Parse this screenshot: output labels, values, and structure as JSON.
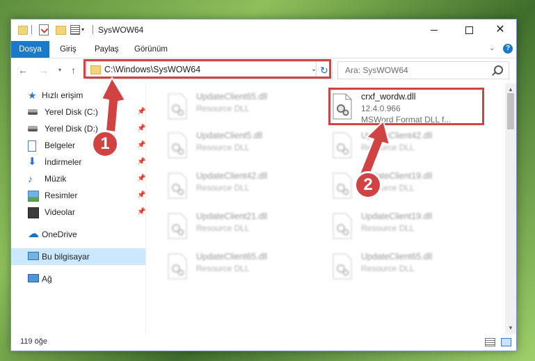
{
  "window": {
    "title": "SysWOW64"
  },
  "ribbon": {
    "tabs": [
      "Dosya",
      "Giriş",
      "Paylaş",
      "Görünüm"
    ]
  },
  "nav": {
    "address": "C:\\Windows\\SysWOW64",
    "search_placeholder": "Ara: SysWOW64"
  },
  "sidebar": {
    "quick_access": "Hızlı erişim",
    "items": [
      {
        "label": "Yerel Disk (C:)",
        "icon": "disk-icon"
      },
      {
        "label": "Yerel Disk (D:)",
        "icon": "disk-icon"
      },
      {
        "label": "Belgeler",
        "icon": "documents-icon"
      },
      {
        "label": "İndirmeler",
        "icon": "downloads-icon"
      },
      {
        "label": "Müzik",
        "icon": "music-icon"
      },
      {
        "label": "Resimler",
        "icon": "pictures-icon"
      },
      {
        "label": "Videolar",
        "icon": "videos-icon"
      }
    ],
    "onedrive": "OneDrive",
    "this_pc": "Bu bilgisayar",
    "network": "Ağ"
  },
  "files": {
    "left_column": [
      {
        "name": "UpdateClient65.dll",
        "type": "Resource DLL"
      },
      {
        "name": "UpdateClient5.dll",
        "type": "Resource DLL"
      },
      {
        "name": "UpdateClient42.dll",
        "type": "Resource DLL"
      },
      {
        "name": "UpdateClient21.dll",
        "type": "Resource DLL"
      },
      {
        "name": "UpdateClient65.dll",
        "type": "Resource DLL"
      }
    ],
    "right_column": [
      {
        "name": "crxf_wordw.dll",
        "version": "12.4.0.966",
        "description": "MSWord Format DLL f..."
      },
      {
        "name": "UpdateClient42.dll",
        "type": "Resource DLL"
      },
      {
        "name": "UpdateClient19.dll",
        "type": "Resource DLL"
      },
      {
        "name": "UpdateClient19.dll",
        "type": "Resource DLL"
      },
      {
        "name": "UpdateClient65.dll",
        "type": "Resource DLL"
      }
    ]
  },
  "status": {
    "item_count": "119 öğe"
  },
  "annotations": {
    "step1": "1",
    "step2": "2",
    "color": "#d14343"
  },
  "colors": {
    "accent": "#1979ca",
    "selection": "#cce8ff"
  }
}
